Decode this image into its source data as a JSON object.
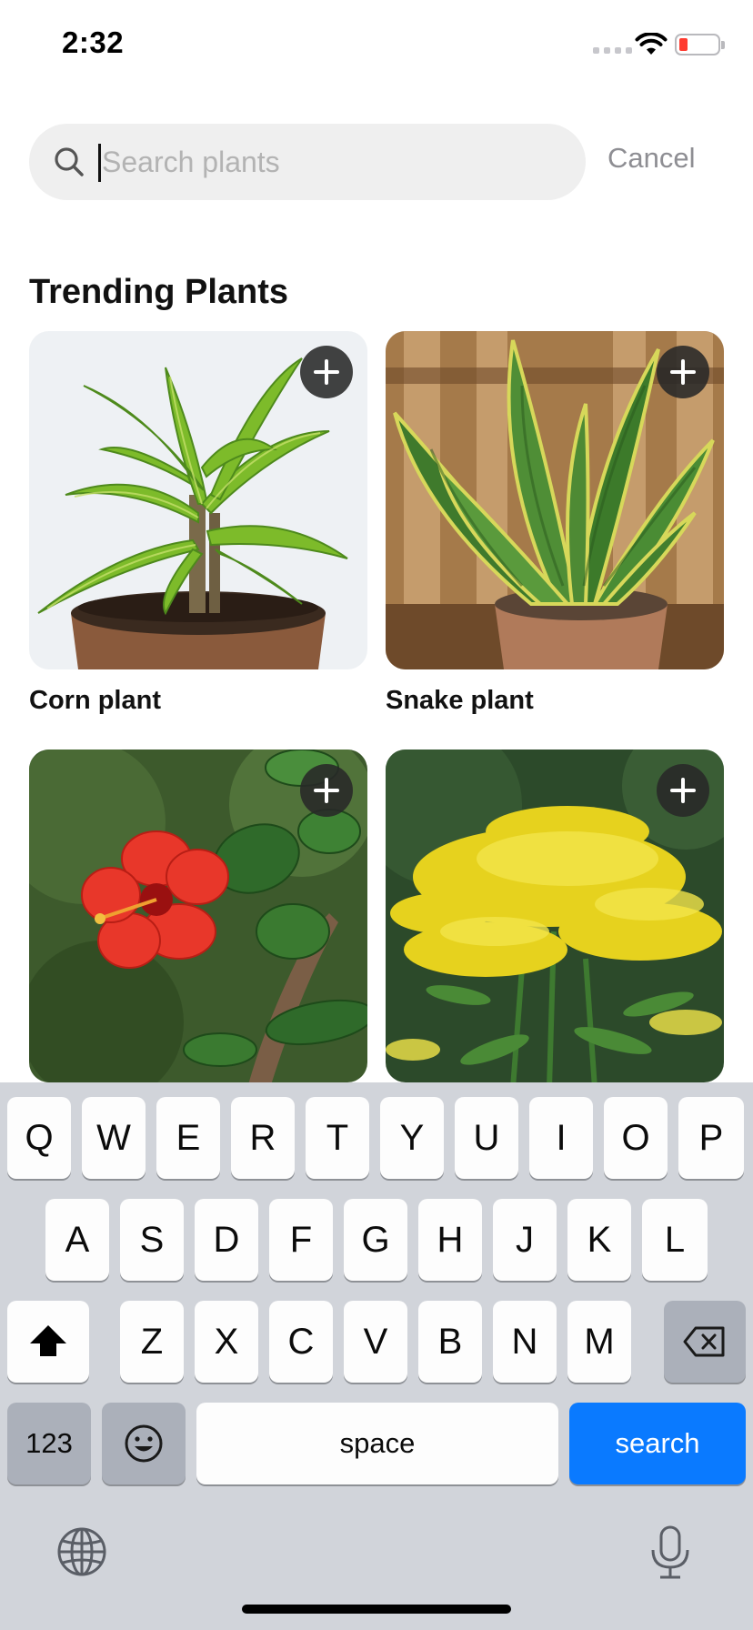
{
  "status_bar": {
    "time": "2:32"
  },
  "search": {
    "placeholder": "Search plants",
    "value": "",
    "cancel_label": "Cancel"
  },
  "section": {
    "title": "Trending Plants"
  },
  "plants": [
    {
      "name": "Corn plant"
    },
    {
      "name": "Snake plant"
    }
  ],
  "keyboard": {
    "row1": [
      "Q",
      "W",
      "E",
      "R",
      "T",
      "Y",
      "U",
      "I",
      "O",
      "P"
    ],
    "row2": [
      "A",
      "S",
      "D",
      "F",
      "G",
      "H",
      "J",
      "K",
      "L"
    ],
    "row3": [
      "Z",
      "X",
      "C",
      "V",
      "B",
      "N",
      "M"
    ],
    "numbers_label": "123",
    "space_label": "space",
    "search_label": "search",
    "icons": [
      "shift-icon",
      "backspace-icon",
      "emoji-icon",
      "globe-icon",
      "microphone-icon"
    ]
  },
  "colors": {
    "accent": "#0a7aff",
    "battery_low": "#ff3b30"
  }
}
